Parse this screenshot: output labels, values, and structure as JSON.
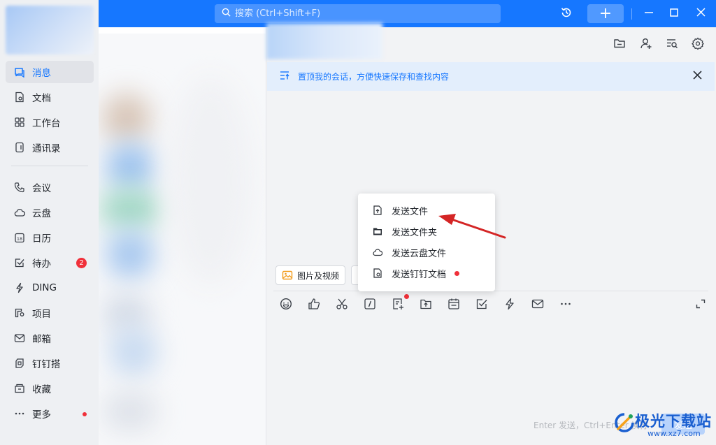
{
  "titlebar": {
    "search_placeholder": "搜索 (Ctrl+Shift+F)",
    "add_label": "+"
  },
  "nav": {
    "items": [
      {
        "label": "消息",
        "icon": "chat-icon"
      },
      {
        "label": "文档",
        "icon": "document-icon"
      },
      {
        "label": "工作台",
        "icon": "grid-icon"
      },
      {
        "label": "通讯录",
        "icon": "contacts-icon"
      },
      {
        "label": "会议",
        "icon": "phone-icon"
      },
      {
        "label": "云盘",
        "icon": "cloud-icon"
      },
      {
        "label": "日历",
        "icon": "calendar-icon",
        "icon_text": "18"
      },
      {
        "label": "待办",
        "icon": "todo-icon",
        "badge": "2"
      },
      {
        "label": "DING",
        "icon": "lightning-icon"
      },
      {
        "label": "项目",
        "icon": "project-icon"
      },
      {
        "label": "邮箱",
        "icon": "mail-icon"
      },
      {
        "label": "钉钉搭",
        "icon": "builder-icon"
      },
      {
        "label": "收藏",
        "icon": "favorite-icon"
      },
      {
        "label": "更多",
        "icon": "more-icon"
      }
    ]
  },
  "chat": {
    "pin_text": "置顶我的会话，方便快速保存和查找内容",
    "quick_chip_label": "图片及视频",
    "input_hint": "Enter 发送，Ctrl+Enter 换行",
    "send_label": "发送"
  },
  "popup": {
    "items": [
      {
        "label": "发送文件",
        "icon": "upload-file-icon"
      },
      {
        "label": "发送文件夹",
        "icon": "folder-icon"
      },
      {
        "label": "发送云盘文件",
        "icon": "cloud-icon"
      },
      {
        "label": "发送钉钉文档",
        "icon": "dingtalk-doc-icon"
      }
    ]
  },
  "watermark": {
    "title": "极光下载站",
    "url": "www.xz7.com"
  },
  "colors": {
    "brand": "#1677ff",
    "badge": "#f0303a",
    "arrow": "#d42525"
  }
}
